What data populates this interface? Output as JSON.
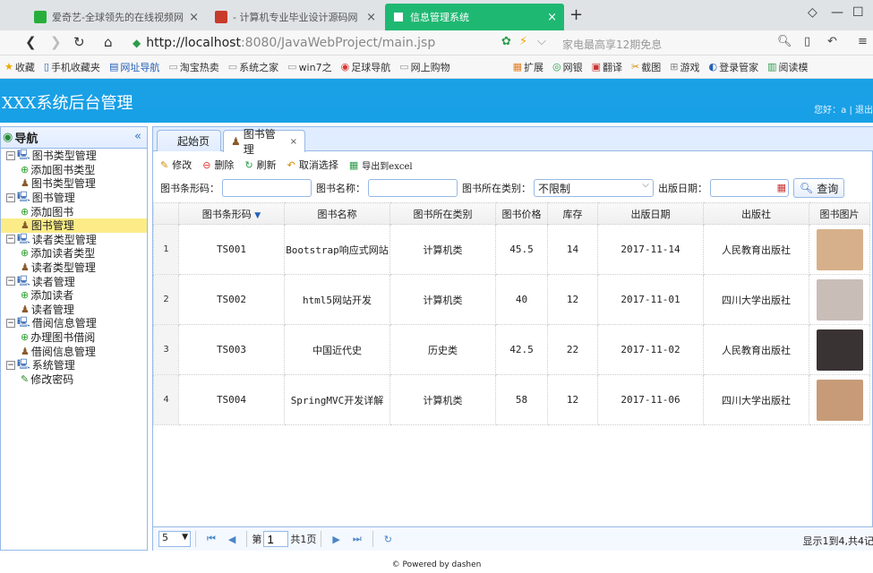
{
  "browser": {
    "tabs": [
      {
        "title": "爱奇艺-全球领先的在线视频网站",
        "favicon_color": "#27ae3a"
      },
      {
        "title": "- 计算机专业毕业设计源码网",
        "favicon_color": "#c83a2a"
      },
      {
        "title": "信息管理系统",
        "favicon_color": "#ffffff",
        "active": true
      }
    ],
    "new_tab": "+",
    "url_host": "http://localhost",
    "url_path": ":8080/JavaWebProject/main.jsp",
    "url_hint": "家电最高享12期免息",
    "bookmarks": [
      "收藏",
      "手机收藏夹",
      "网址导航",
      "淘宝热卖",
      "系统之家",
      "win7之",
      "足球导航",
      "网上购物",
      "扩展",
      "网银",
      "翻译",
      "截图",
      "游戏",
      "登录管家",
      "阅读模"
    ]
  },
  "app": {
    "title": "XXX系统后台管理",
    "greeting": "您好：a  |  退出"
  },
  "nav": {
    "title": "导航",
    "collapse": "«",
    "groups": [
      {
        "label": "图书类型管理",
        "items": [
          {
            "label": "添加图书类型",
            "icon": "add-icon"
          },
          {
            "label": "图书类型管理",
            "icon": "user-icon"
          }
        ]
      },
      {
        "label": "图书管理",
        "items": [
          {
            "label": "添加图书",
            "icon": "add-icon"
          },
          {
            "label": "图书管理",
            "icon": "user-icon",
            "selected": true
          }
        ]
      },
      {
        "label": "读者类型管理",
        "items": [
          {
            "label": "添加读者类型",
            "icon": "add-icon"
          },
          {
            "label": "读者类型管理",
            "icon": "user-icon"
          }
        ]
      },
      {
        "label": "读者管理",
        "items": [
          {
            "label": "添加读者",
            "icon": "add-icon"
          },
          {
            "label": "读者管理",
            "icon": "user-icon"
          }
        ]
      },
      {
        "label": "借阅信息管理",
        "items": [
          {
            "label": "办理图书借阅",
            "icon": "add-icon"
          },
          {
            "label": "借阅信息管理",
            "icon": "user-icon"
          }
        ]
      },
      {
        "label": "系统管理",
        "items": [
          {
            "label": "修改密码",
            "icon": "pen-icon"
          }
        ]
      }
    ]
  },
  "tabs": {
    "home": "起始页",
    "books": "图书管理",
    "close": "×"
  },
  "toolbar": {
    "edit": "修改",
    "delete": "删除",
    "refresh": "刷新",
    "cancel_select": "取消选择",
    "export": "导出到excel"
  },
  "search": {
    "barcode_label": "图书条形码：",
    "name_label": "图书名称：",
    "category_label": "图书所在类别：",
    "category_value": "不限制",
    "date_label": "出版日期：",
    "query_button": "查询"
  },
  "grid": {
    "columns": [
      "图书条形码",
      "图书名称",
      "图书所在类别",
      "图书价格",
      "库存",
      "出版日期",
      "出版社",
      "图书图片"
    ],
    "rows": [
      {
        "n": "1",
        "barcode": "TS001",
        "name": "Bootstrap响应式网站",
        "category": "计算机类",
        "price": "45.5",
        "stock": "14",
        "date": "2017-11-14",
        "publisher": "人民教育出版社",
        "pic_color": "#d6b08a"
      },
      {
        "n": "2",
        "barcode": "TS002",
        "name": "html5网站开发",
        "category": "计算机类",
        "price": "40",
        "stock": "12",
        "date": "2017-11-01",
        "publisher": "四川大学出版社",
        "pic_color": "#c9bdb8"
      },
      {
        "n": "3",
        "barcode": "TS003",
        "name": "中国近代史",
        "category": "历史类",
        "price": "42.5",
        "stock": "22",
        "date": "2017-11-02",
        "publisher": "人民教育出版社",
        "pic_color": "#3a3334"
      },
      {
        "n": "4",
        "barcode": "TS004",
        "name": "SpringMVC开发详解",
        "category": "计算机类",
        "price": "58",
        "stock": "12",
        "date": "2017-11-06",
        "publisher": "四川大学出版社",
        "pic_color": "#c79b78"
      }
    ]
  },
  "pager": {
    "page_size": "5",
    "page_prefix": "第",
    "page_value": "1",
    "page_suffix": "共1页",
    "info": "显示1到4,共4记"
  },
  "footer": "© Powered by dashen",
  "colors": {
    "accent": "#18a0e6",
    "border": "#95b8e7",
    "tab_active": "#1fb872"
  }
}
